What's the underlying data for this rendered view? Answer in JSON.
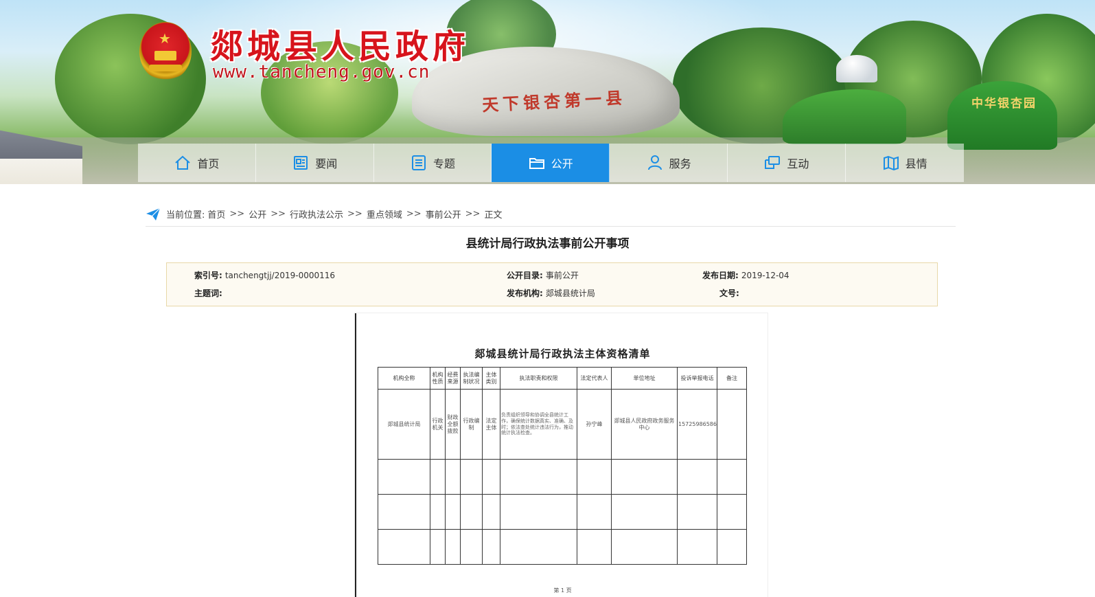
{
  "header": {
    "site_title": "郯城县人民政府",
    "site_url": "www.tancheng.gov.cn",
    "stone_inscription": "天下银杏第一县",
    "park_sign": "中华银杏园"
  },
  "nav": {
    "items": [
      {
        "label": "首页",
        "icon": "home-icon"
      },
      {
        "label": "要闻",
        "icon": "newspaper-icon"
      },
      {
        "label": "专题",
        "icon": "list-doc-icon"
      },
      {
        "label": "公开",
        "icon": "folder-icon",
        "active": true
      },
      {
        "label": "服务",
        "icon": "user-icon"
      },
      {
        "label": "互动",
        "icon": "chat-icon"
      },
      {
        "label": "县情",
        "icon": "map-icon"
      }
    ]
  },
  "breadcrumb": {
    "prefix": "当前位置:",
    "items": [
      "首页",
      "公开",
      "行政执法公示",
      "重点领域",
      "事前公开",
      "正文"
    ],
    "separator": ">>"
  },
  "article": {
    "title": "县统计局行政执法事前公开事项"
  },
  "meta": {
    "index_label": "索引号:",
    "index_value": "tanchengtjj/2019-0000116",
    "catalog_label": "公开目录:",
    "catalog_value": "事前公开",
    "date_label": "发布日期:",
    "date_value": "2019-12-04",
    "keywords_label": "主题词:",
    "keywords_value": "",
    "publisher_label": "发布机构:",
    "publisher_value": "郯城县统计局",
    "docno_label": "文号:",
    "docno_value": ""
  },
  "document": {
    "title": "郯城县统计局行政执法主体资格清单",
    "headers": [
      "机构全称",
      "机构性质",
      "经费来源",
      "执法编制状况",
      "主体类别",
      "执法职责和权限",
      "法定代表人",
      "单位地址",
      "投诉举报电话",
      "备注"
    ],
    "row": {
      "org": "郯城县统计局",
      "nature": "行政机关",
      "funding": "财政全额拨款",
      "staffing": "行政编制",
      "category": "法定主体",
      "duty": "负责组织领导和协调全县统计工作，确保统计数据真实、准确、及时；依法查处统计违法行为，推动统计执法检查。",
      "rep": "孙宁峰",
      "address": "郯城县人民政府政务服务中心",
      "phone": "15725986586",
      "remark": ""
    },
    "footer": "第 1 页"
  }
}
